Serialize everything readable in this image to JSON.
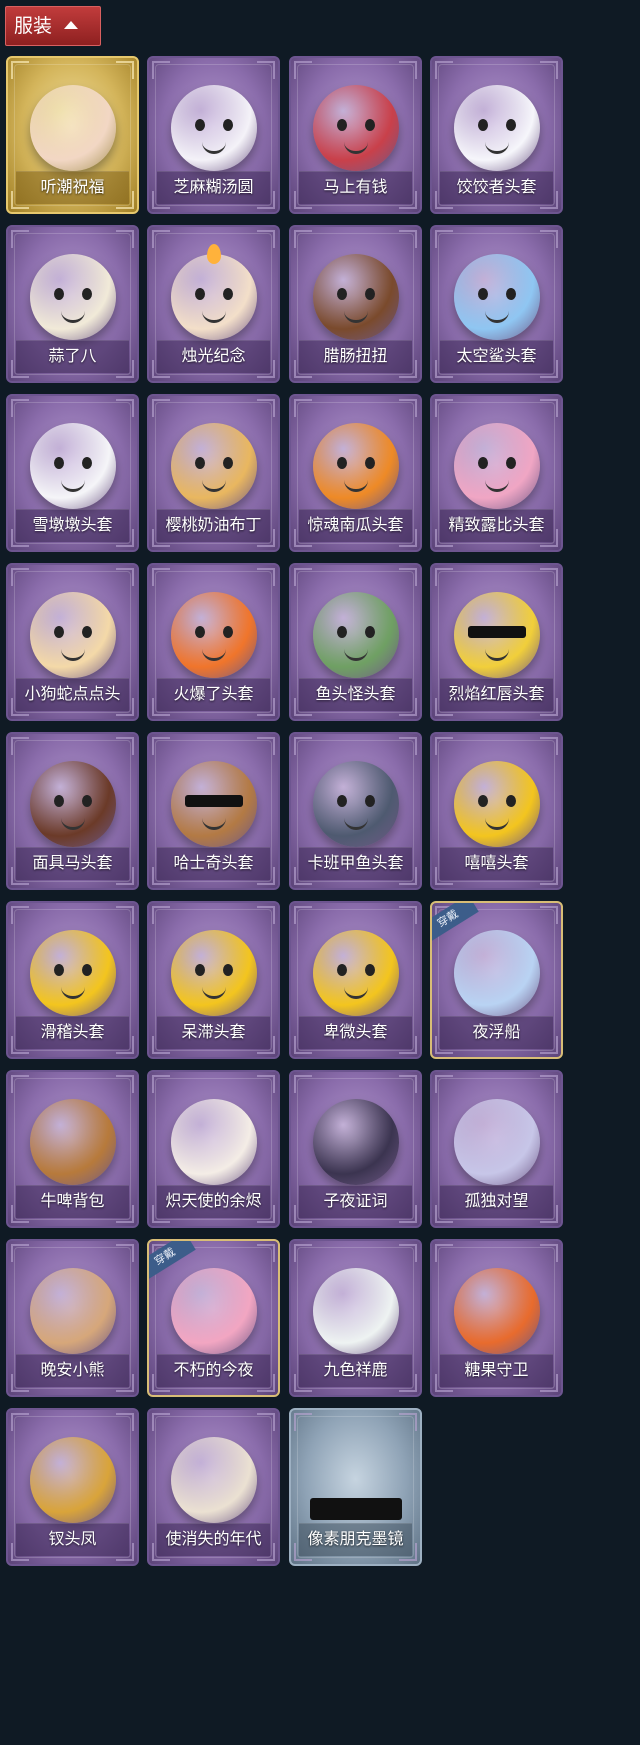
{
  "header": {
    "label": "服装",
    "icon": "chevron-up-icon"
  },
  "items": [
    {
      "name": "听潮祝福",
      "style": "gold",
      "color": "#f2d7c4",
      "equipped": false,
      "icon": "angel-figure-icon"
    },
    {
      "name": "芝麻糊汤圆",
      "style": "purple",
      "color": "#f4f2f8",
      "equipped": false,
      "icon": "rice-ball-head-icon"
    },
    {
      "name": "马上有钱",
      "style": "purple",
      "color": "#c9404a",
      "equipped": false,
      "icon": "horse-head-icon"
    },
    {
      "name": "饺饺者头套",
      "style": "purple",
      "color": "#f6f6fb",
      "equipped": false,
      "icon": "cloud-head-icon"
    },
    {
      "name": "蒜了八",
      "style": "purple",
      "color": "#f1ead8",
      "equipped": false,
      "icon": "garlic-head-icon"
    },
    {
      "name": "烛光纪念",
      "style": "purple",
      "color": "#f3dfc9",
      "equipped": false,
      "icon": "candle-head-icon"
    },
    {
      "name": "腊肠扭扭",
      "style": "purple",
      "color": "#7a4a2c",
      "equipped": false,
      "icon": "dachshund-head-icon"
    },
    {
      "name": "太空鲨头套",
      "style": "purple",
      "color": "#8fc6f2",
      "equipped": false,
      "icon": "shark-head-icon"
    },
    {
      "name": "雪墩墩头套",
      "style": "purple",
      "color": "#f5f5f8",
      "equipped": false,
      "icon": "snowman-head-icon"
    },
    {
      "name": "樱桃奶油布丁",
      "style": "purple",
      "color": "#e9b75f",
      "equipped": false,
      "icon": "pudding-head-icon"
    },
    {
      "name": "惊魂南瓜头套",
      "style": "purple",
      "color": "#ee8a26",
      "equipped": false,
      "icon": "pumpkin-head-icon"
    },
    {
      "name": "精致露比头套",
      "style": "purple",
      "color": "#f0a6c4",
      "equipped": false,
      "icon": "pink-beaver-head-icon"
    },
    {
      "name": "小狗蛇点点头",
      "style": "purple",
      "color": "#f4d9a8",
      "equipped": false,
      "icon": "snake-head-icon"
    },
    {
      "name": "火爆了头套",
      "style": "purple",
      "color": "#f0752b",
      "equipped": false,
      "icon": "fire-head-icon"
    },
    {
      "name": "鱼头怪头套",
      "style": "purple",
      "color": "#6fa063",
      "equipped": false,
      "icon": "fish-head-icon"
    },
    {
      "name": "烈焰红唇头套",
      "style": "purple",
      "color": "#f1cf3a",
      "equipped": false,
      "icon": "pikachu-head-icon"
    },
    {
      "name": "面具马头套",
      "style": "purple",
      "color": "#6b3a28",
      "equipped": false,
      "icon": "horse-mask-icon"
    },
    {
      "name": "哈士奇头套",
      "style": "purple",
      "color": "#b37a44",
      "equipped": false,
      "icon": "husky-head-icon"
    },
    {
      "name": "卡班甲鱼头套",
      "style": "purple",
      "color": "#4e5a70",
      "equipped": false,
      "icon": "whale-head-icon"
    },
    {
      "name": "嘻嘻头套",
      "style": "purple",
      "color": "#f3c51e",
      "equipped": false,
      "icon": "grin-emoji-icon"
    },
    {
      "name": "滑稽头套",
      "style": "purple",
      "color": "#f3c51e",
      "equipped": false,
      "icon": "smirk-emoji-icon"
    },
    {
      "name": "呆滞头套",
      "style": "purple",
      "color": "#f3c51e",
      "equipped": false,
      "icon": "stare-emoji-icon"
    },
    {
      "name": "卑微头套",
      "style": "purple",
      "color": "#f3c51e",
      "equipped": false,
      "icon": "sad-emoji-icon"
    },
    {
      "name": "夜浮船",
      "style": "purple",
      "color": "#b9d3f3",
      "equipped": true,
      "icon": "jellyfish-icon"
    },
    {
      "name": "牛啤背包",
      "style": "purple",
      "color": "#b77a3b",
      "equipped": false,
      "icon": "beer-barrel-backpack-icon"
    },
    {
      "name": "炽天使的余烬",
      "style": "purple",
      "color": "#f4ede6",
      "equipped": false,
      "icon": "angel-doll-icon"
    },
    {
      "name": "子夜证词",
      "style": "purple",
      "color": "#3b3450",
      "equipped": false,
      "icon": "crow-doll-icon"
    },
    {
      "name": "孤独对望",
      "style": "purple",
      "color": "#c7c6e8",
      "equipped": false,
      "icon": "princess-doll-icon"
    },
    {
      "name": "晚安小熊",
      "style": "purple",
      "color": "#d6a77a",
      "equipped": false,
      "icon": "bear-pendant-icon"
    },
    {
      "name": "不朽的今夜",
      "style": "purple",
      "color": "#f2a6c2",
      "equipped": true,
      "icon": "pink-cat-cup-icon"
    },
    {
      "name": "九色祥鹿",
      "style": "purple",
      "color": "#eef3f2",
      "equipped": false,
      "icon": "deer-pendant-icon"
    },
    {
      "name": "糖果守卫",
      "style": "purple",
      "color": "#e86b2d",
      "equipped": false,
      "icon": "pumpkin-scarecrow-icon"
    },
    {
      "name": "钗头凤",
      "style": "purple",
      "color": "#d9a43a",
      "equipped": false,
      "icon": "phoenix-crown-doll-icon"
    },
    {
      "name": "使消失的年代",
      "style": "purple",
      "color": "#ebe1d2",
      "equipped": false,
      "icon": "veiled-doll-icon"
    },
    {
      "name": "像素朋克墨镜",
      "style": "grey",
      "color": "#111111",
      "equipped": false,
      "icon": "pixel-sunglasses-icon"
    }
  ],
  "badge_label": "穿戴"
}
